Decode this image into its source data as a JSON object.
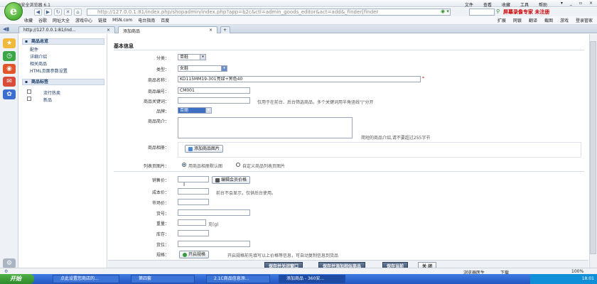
{
  "window": {
    "title": "360安全浏览器 6.1",
    "menus": [
      "文件",
      "查看",
      "收藏",
      "工具",
      "帮助"
    ],
    "controls": [
      "▾",
      "_",
      "▫",
      "×"
    ]
  },
  "address_bar": {
    "url": "http://127.0.0.1:81/index.php/shopadmin/index.php?app=b2c&ctl=admin_goods_editor&act=add&_finder[finder",
    "promo": "屏幕录像专家 未注册"
  },
  "favorites": {
    "items": [
      "收藏",
      "谷歌",
      "网址大全",
      "游戏中心",
      "链接",
      "MSN.com",
      "电台指南",
      "百度"
    ],
    "right_items": [
      "扩展",
      "网银",
      "翻译",
      "截图",
      "游戏",
      "登录管家"
    ]
  },
  "tabs": [
    {
      "label": "http://127.0.0.1:81/ind..."
    },
    {
      "label": "添加商品"
    }
  ],
  "sidebar": {
    "section1_title": "商品总览",
    "section1_items": [
      "配件",
      "详细介绍",
      "相关商品",
      "HTML页面参数设置"
    ],
    "section2_title": "商品标签",
    "section2_items": [
      "流行热卖",
      "新品"
    ]
  },
  "form": {
    "heading": "基本信息",
    "category_label": "分类：",
    "category_value": "单鞋",
    "type_label": "类型：",
    "type_value": "女鞋",
    "name_label": "商品名称：",
    "name_value": "KD115MM19-301亮绿+黑色40",
    "bn_label": "商品编号：",
    "bn_value": "CM001",
    "keywords_label": "商品关键词：",
    "keywords_note": "仅用于在前台、后台筛选商品，多个关键词用半角竖线\"|\"分开",
    "brand_label": "品牌：",
    "brand_value": "百丽",
    "brief_label": "商品简介：",
    "brief_note": "简短的商品介绍,请不要超过255字节",
    "image_label": "商品相册：",
    "add_image_button": "添加商品图片",
    "list_image_label": "列表页图片：",
    "list_image_opt1": "用商品相册默认图",
    "list_image_opt2": "自定义商品列表页图片",
    "price_label": "销售价：",
    "member_price_button": "编辑会员价格",
    "cost_label": "成本价：",
    "cost_note": "前台不会显示，仅供后台使用。",
    "mktprice_label": "市场价：",
    "barcode_label": "货号：",
    "weight_label": "重量：",
    "weight_unit": "克(g)",
    "store_label": "库存：",
    "store_place_label": "货位：",
    "spec_label": "规格：",
    "spec_button": "开启规格",
    "spec_note": "开启规格前先填写以上价格等信息，可自动复制信息到货品"
  },
  "actions": {
    "save_close": "保存并关闭窗口",
    "save_add": "保存并添加相似商品",
    "save_current": "保存当前",
    "close": "关 闭"
  },
  "statusbar": {
    "right_items": [
      "浏览器医生",
      "下载",
      "100%"
    ]
  },
  "taskbar": {
    "start": "开始",
    "tasks": [
      "点此设置您商店的...",
      "第四套",
      "2.1C商品信息添...",
      "添加商品 - 360安..."
    ],
    "clock": "18:01"
  }
}
